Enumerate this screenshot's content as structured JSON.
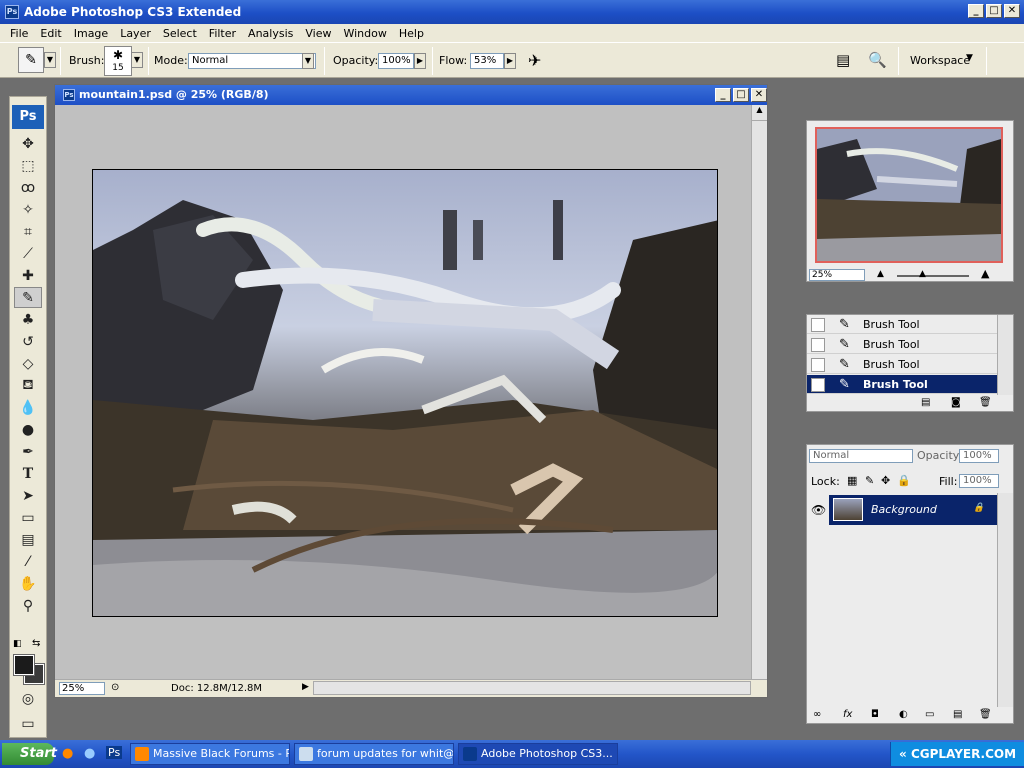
{
  "app": {
    "title": "Adobe Photoshop CS3 Extended",
    "logo": "Ps"
  },
  "menu": [
    "File",
    "Edit",
    "Image",
    "Layer",
    "Select",
    "Filter",
    "Analysis",
    "View",
    "Window",
    "Help"
  ],
  "options": {
    "brush_label": "Brush:",
    "brush_size": "15",
    "mode_label": "Mode:",
    "mode_value": "Normal",
    "opacity_label": "Opacity:",
    "opacity_value": "100%",
    "flow_label": "Flow:",
    "flow_value": "53%",
    "workspace_label": "Workspace"
  },
  "document": {
    "title": "mountain1.psd @ 25% (RGB/8)",
    "zoom": "25%",
    "doc_info": "Doc: 12.8M/12.8M"
  },
  "navigator": {
    "zoom": "25%"
  },
  "history": {
    "items": [
      "Brush Tool",
      "Brush Tool",
      "Brush Tool",
      "Brush Tool"
    ],
    "selected_index": 3
  },
  "layers": {
    "blend_mode": "Normal",
    "opacity_label": "Opacity:",
    "opacity_value": "100%",
    "lock_label": "Lock:",
    "fill_label": "Fill:",
    "fill_value": "100%",
    "layer_name": "Background"
  },
  "taskbar": {
    "start_label": "Start",
    "tasks": [
      "Massive Black Forums - P...",
      "forum updates for whit@...",
      "Adobe Photoshop CS3..."
    ],
    "active_index": 2,
    "tray_text": "CGPLAYER.COM"
  },
  "colors": {
    "title_blue": "#1d4fc6",
    "selection_navy": "#0a246a",
    "foreground": "#1b1b1b",
    "background": "#3a3a3a"
  }
}
